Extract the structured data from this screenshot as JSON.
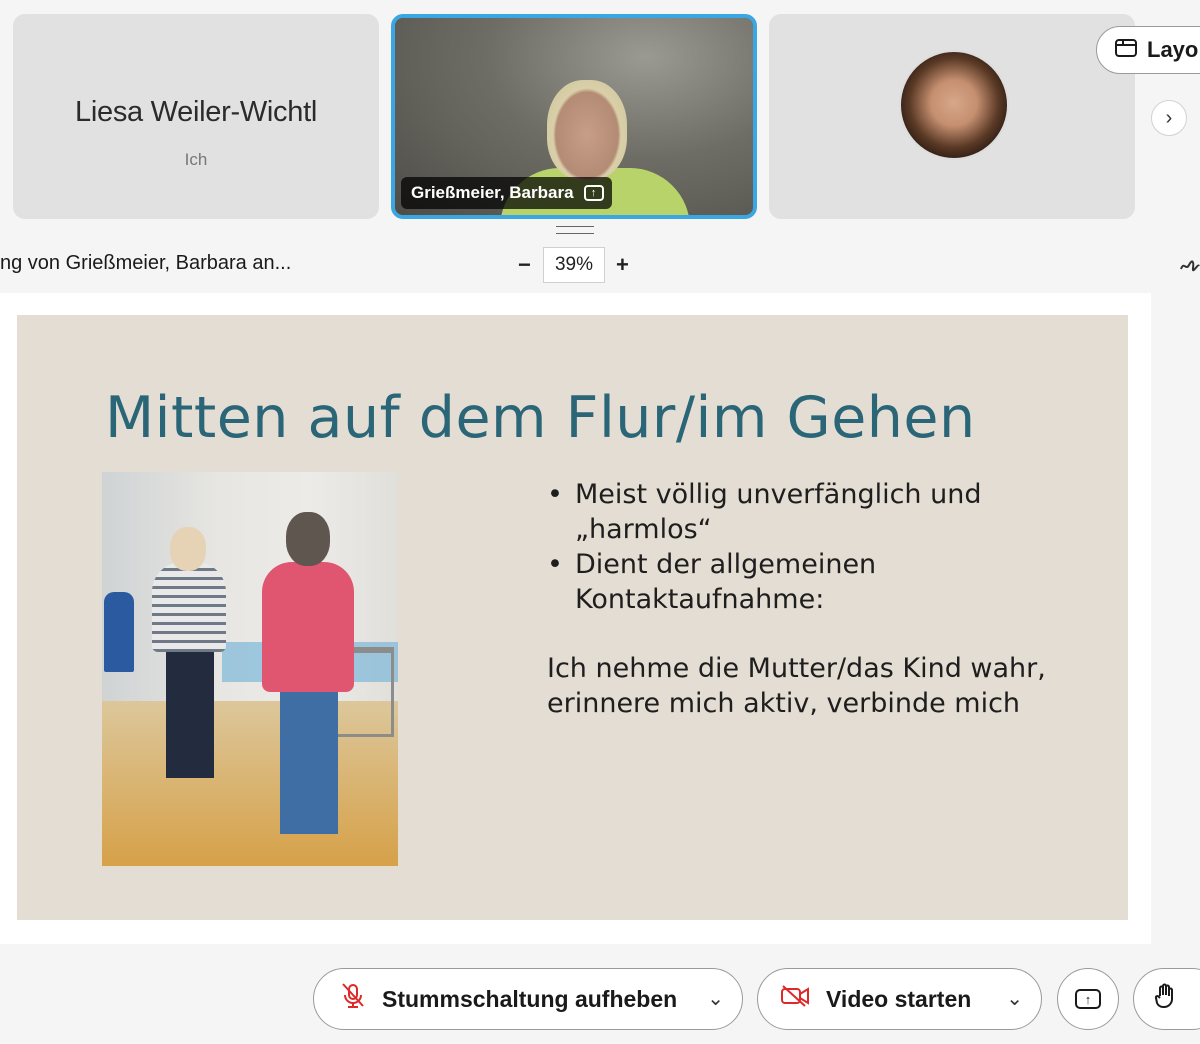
{
  "participants": {
    "self": {
      "name": "Liesa Weiler-Wichtl",
      "subtitle": "Ich"
    },
    "speaker": {
      "name": "Grießmeier, Barbara",
      "share_icon": "screen-share-icon",
      "highlight_color": "#3aa6e2"
    },
    "third": {
      "avatar_icon": "profile-photo"
    }
  },
  "header": {
    "layout_label": "Layo",
    "layout_icon": "layout-icon",
    "next_icon": "chevron-right-icon"
  },
  "share_bar": {
    "viewing_label": "ng von Grießmeier, Barbara an...",
    "zoom_minus": "−",
    "zoom_value": "39%",
    "zoom_plus": "+",
    "annotate_icon": "annotate-icon"
  },
  "slide": {
    "title": "Mitten auf dem Flur/im Gehen",
    "title_color": "#2a6677",
    "background_color": "#e4ddd3",
    "bullets": [
      {
        "line1": "Meist völlig unverfänglich und",
        "line2": "„harmlos“"
      },
      {
        "line1": "Dient der allgemeinen",
        "line2": "Kontaktaufnahme:"
      }
    ],
    "paragraph": {
      "line1": "Ich nehme die Mutter/das Kind wahr,",
      "line2": "erinnere mich aktiv, verbinde mich"
    }
  },
  "toolbar": {
    "mute_label": "Stummschaltung aufheben",
    "mute_icon": "microphone-muted-icon",
    "video_label": "Video starten",
    "video_icon": "video-off-icon",
    "share_icon": "share-screen-icon",
    "reaction_icon": "raise-hand-icon",
    "muted_color": "#e02828"
  }
}
